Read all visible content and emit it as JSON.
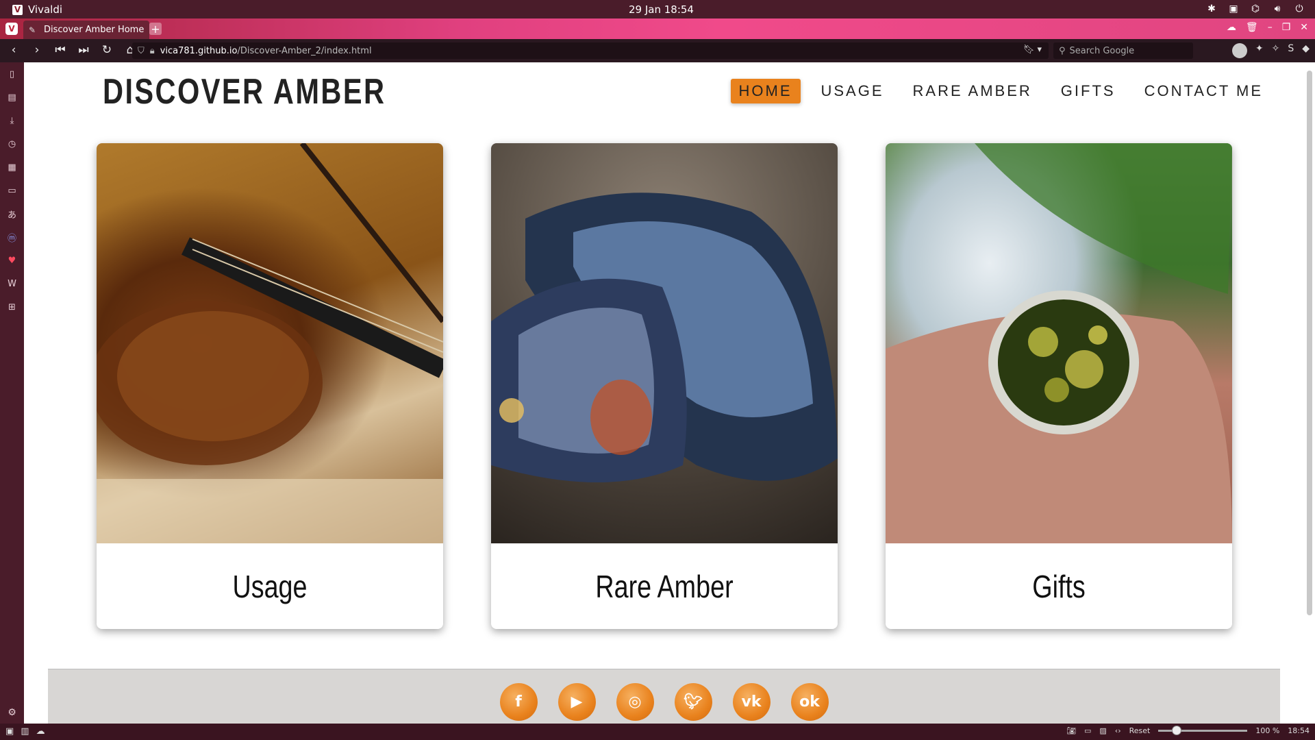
{
  "os": {
    "app_name": "Vivaldi",
    "clock": "29 Jan  18:54"
  },
  "browser": {
    "tab_title": "Discover Amber Home",
    "url_host": "vica781.github.io",
    "url_path": "/Discover-Amber_2/index.html",
    "search_placeholder": "Search Google"
  },
  "site": {
    "title": "DISCOVER AMBER",
    "nav": [
      "HOME",
      "USAGE",
      "RARE AMBER",
      "GIFTS",
      "CONTACT ME"
    ],
    "active_nav": "HOME",
    "cards": [
      {
        "caption": "Usage",
        "image": "violin-on-sheet-music-image"
      },
      {
        "caption": "Rare Amber",
        "image": "blue-amber-stones-image"
      },
      {
        "caption": "Gifts",
        "image": "amber-ring-on-finger-image"
      }
    ],
    "socials": [
      "facebook-icon",
      "youtube-icon",
      "instagram-icon",
      "twitter-icon",
      "vk-icon",
      "odnoklassniki-icon"
    ],
    "accent_color": "#e9821d"
  },
  "status": {
    "zoom_reset": "Reset",
    "zoom": "100 %",
    "time": "18:54"
  }
}
